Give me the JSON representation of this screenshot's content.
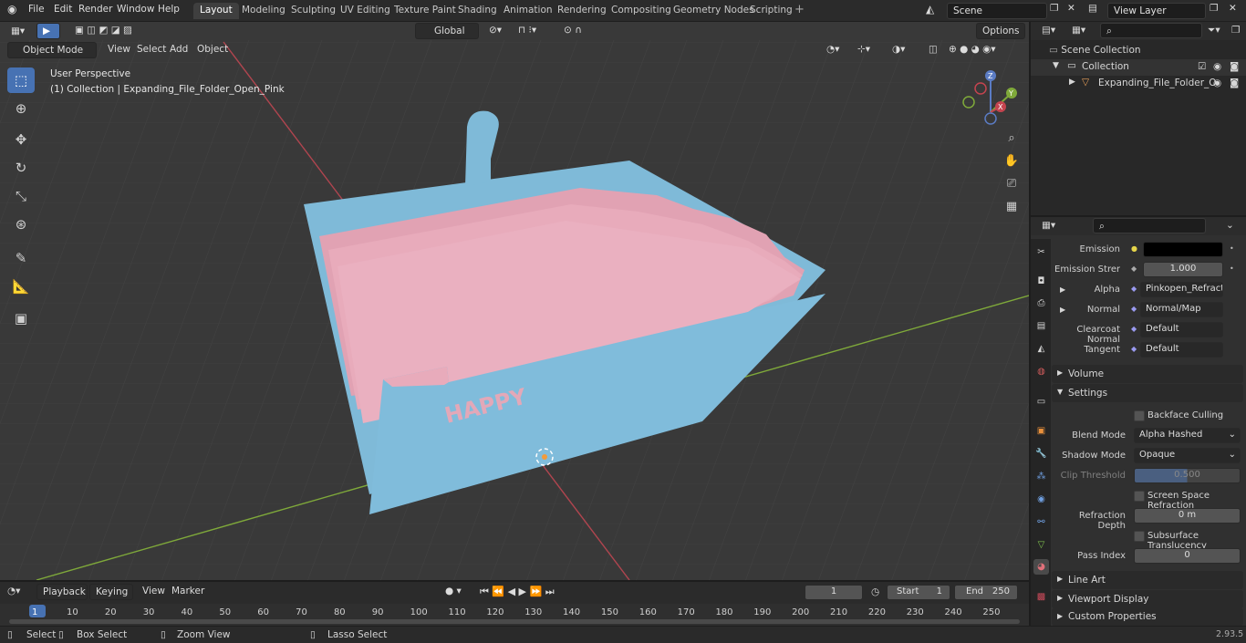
{
  "topbar": {
    "menus": [
      "File",
      "Edit",
      "Render",
      "Window",
      "Help"
    ],
    "workspaces": [
      "Layout",
      "Modeling",
      "Sculpting",
      "UV Editing",
      "Texture Paint",
      "Shading",
      "Animation",
      "Rendering",
      "Compositing",
      "Geometry Nodes",
      "Scripting"
    ],
    "active_workspace": "Layout",
    "scene_name": "Scene",
    "view_layer": "View Layer"
  },
  "viewport_header": {
    "mode": "Object Mode",
    "menus": [
      "View",
      "Select",
      "Add",
      "Object"
    ],
    "orientation": "Global",
    "options": "Options"
  },
  "viewport": {
    "perspective_label": "User Perspective",
    "collection_label": "(1) Collection | Expanding_File_Folder_Open_Pink",
    "axis_x": "X",
    "axis_y": "Y",
    "axis_z": "Z",
    "folder_text": "HAPPY"
  },
  "outliner": {
    "scene_collection": "Scene Collection",
    "collection": "Collection",
    "object": "Expanding_File_Folder_O"
  },
  "properties": {
    "emission_label": "Emission",
    "emission_strength_label": "Emission Strengt",
    "emission_strength_value": "1.000",
    "alpha_label": "Alpha",
    "alpha_value": "Pinkopen_Refractio...",
    "normal_label": "Normal",
    "normal_value": "Normal/Map",
    "clearcoat_label": "Clearcoat Normal",
    "clearcoat_value": "Default",
    "tangent_label": "Tangent",
    "tangent_value": "Default",
    "volume_panel": "Volume",
    "settings_panel": "Settings",
    "backface_culling": "Backface Culling",
    "blend_mode_label": "Blend Mode",
    "blend_mode_value": "Alpha Hashed",
    "shadow_mode_label": "Shadow Mode",
    "shadow_mode_value": "Opaque",
    "clip_threshold_label": "Clip Threshold",
    "clip_threshold_value": "0.500",
    "ssr": "Screen Space Refraction",
    "refraction_depth_label": "Refraction Depth",
    "refraction_depth_value": "0 m",
    "subsurface": "Subsurface Translucency",
    "pass_index_label": "Pass Index",
    "pass_index_value": "0",
    "lineart_panel": "Line Art",
    "viewport_display_panel": "Viewport Display",
    "custom_props_panel": "Custom Properties"
  },
  "timeline": {
    "menus": [
      "Playback",
      "Keying",
      "View",
      "Marker"
    ],
    "current_frame": "1",
    "start_label": "Start",
    "start_value": "1",
    "end_label": "End",
    "end_value": "250",
    "ticks": [
      "1",
      "10",
      "20",
      "30",
      "40",
      "50",
      "60",
      "70",
      "80",
      "90",
      "100",
      "110",
      "120",
      "130",
      "140",
      "150",
      "160",
      "170",
      "180",
      "190",
      "200",
      "210",
      "220",
      "230",
      "240",
      "250"
    ]
  },
  "statusbar": {
    "select": "Select",
    "box_select": "Box Select",
    "zoom_view": "Zoom View",
    "lasso_select": "Lasso Select",
    "version": "2.93.5"
  },
  "colors": {
    "accent": "#4772b3",
    "folder_blue": "#7fb9d6",
    "folder_pink": "#e7a6b7",
    "x_axis": "#c4444f",
    "y_axis": "#7fa93a"
  }
}
